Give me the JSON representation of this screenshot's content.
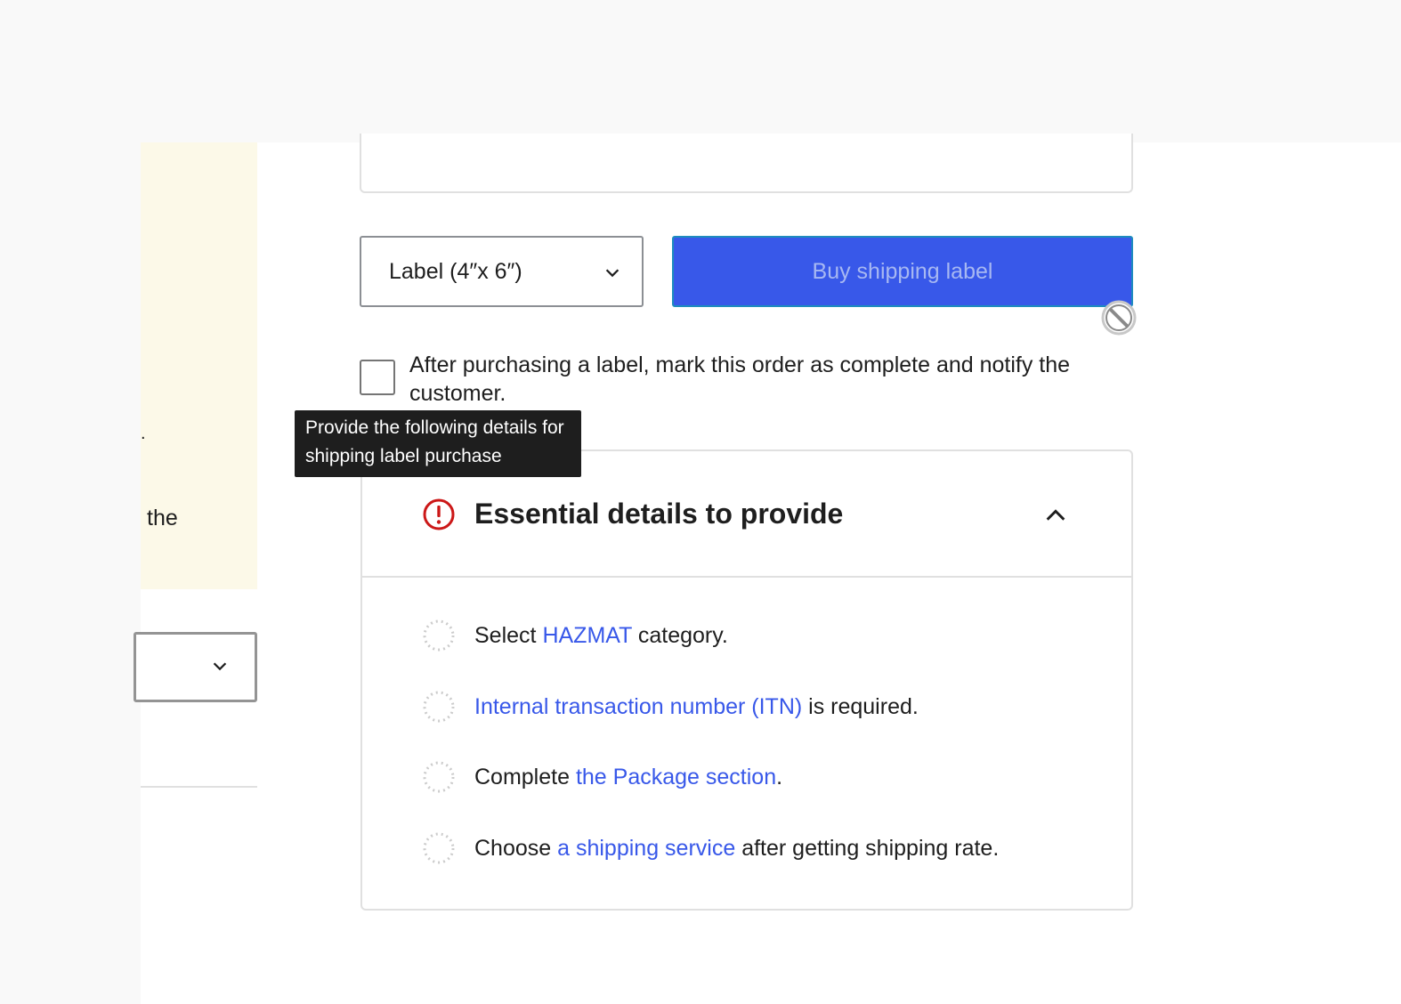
{
  "sidebar_notice": {
    "fragment_dot": ".",
    "fragment_text": "the"
  },
  "label_format": {
    "selected": "Label (4″x 6″)"
  },
  "buy_button": {
    "label": "Buy shipping label",
    "state": "disabled"
  },
  "complete_order": {
    "label": "After purchasing a label, mark this order as complete and notify the customer.",
    "checked": false
  },
  "tooltip": {
    "text": "Provide the following details for shipping label purchase"
  },
  "essential_details": {
    "title": "Essential details to provide",
    "expanded": true,
    "items": [
      {
        "before": "Select ",
        "link": "HAZMAT",
        "after": " category."
      },
      {
        "before": "",
        "link": "Internal transaction number (ITN)",
        "after": " is required."
      },
      {
        "before": "Complete ",
        "link": "the Package section",
        "after": "."
      },
      {
        "before": "Choose ",
        "link": "a shipping service",
        "after": " after getting shipping rate."
      }
    ]
  },
  "colors": {
    "accent": "#3858e9",
    "error": "#cc1818",
    "notice_bg": "#fcf9e8",
    "tooltip_bg": "#1e1e1e"
  }
}
